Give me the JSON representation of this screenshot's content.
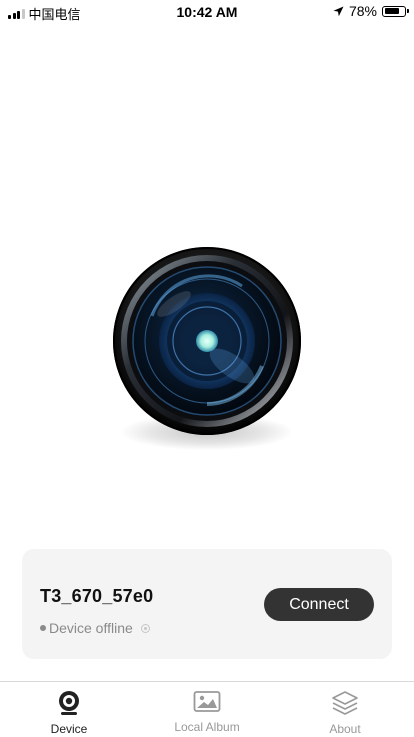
{
  "status_bar": {
    "carrier": "中国电信",
    "time": "10:42 AM",
    "battery": "78%",
    "battery_level": 0.78,
    "icons": [
      "signal-icon",
      "location-icon",
      "battery-icon"
    ]
  },
  "hero": {
    "icon": "camera-lens-icon"
  },
  "device_card": {
    "name": "T3_670_57e0",
    "status": "Device offline",
    "connect_label": "Connect",
    "colors": {
      "card_bg": "#f4f4f4",
      "button_bg": "#333333",
      "status_text": "#8a8a8a"
    }
  },
  "tab_bar": {
    "tabs": [
      {
        "label": "Device",
        "icon": "webcam-icon",
        "active": true
      },
      {
        "label": "Local Album",
        "icon": "image-icon",
        "active": false
      },
      {
        "label": "About",
        "icon": "layers-icon",
        "active": false
      }
    ]
  }
}
